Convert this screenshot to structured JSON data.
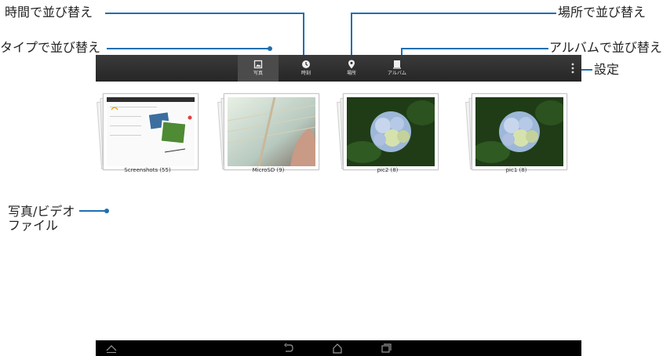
{
  "callouts": {
    "sort_by_time": "時間で並び替え",
    "sort_by_type": "タイプで並び替え",
    "sort_by_location": "場所で並び替え",
    "sort_by_album": "アルバムで並び替え",
    "settings": "設定",
    "media_files_line1": "写真/ビデオ",
    "media_files_line2": "ファイル"
  },
  "actionbar": {
    "tabs": [
      {
        "label": "写真",
        "icon": "photo-icon"
      },
      {
        "label": "時刻",
        "icon": "clock-icon"
      },
      {
        "label": "場所",
        "icon": "location-pin-icon"
      },
      {
        "label": "アルバム",
        "icon": "album-icon"
      }
    ],
    "active_tab": 0,
    "overflow_icon": "overflow-menu-icon",
    "background": "#2e2e2e"
  },
  "albums": [
    {
      "label": "Screenshots (55)",
      "thumb_icon": "screenshot-thumb"
    },
    {
      "label": "MicroSD (9)",
      "thumb_icon": "guitar-thumb"
    },
    {
      "label": "pic2 (8)",
      "thumb_icon": "hydrangea-thumb"
    },
    {
      "label": "pic1 (8)",
      "thumb_icon": "hydrangea-thumb"
    }
  ],
  "navbar": {
    "icons": [
      "collapse-icon",
      "back-icon",
      "home-icon",
      "recent-apps-icon"
    ]
  },
  "colors": {
    "callout_line": "#1f6fb2",
    "navbar": "#000000"
  }
}
